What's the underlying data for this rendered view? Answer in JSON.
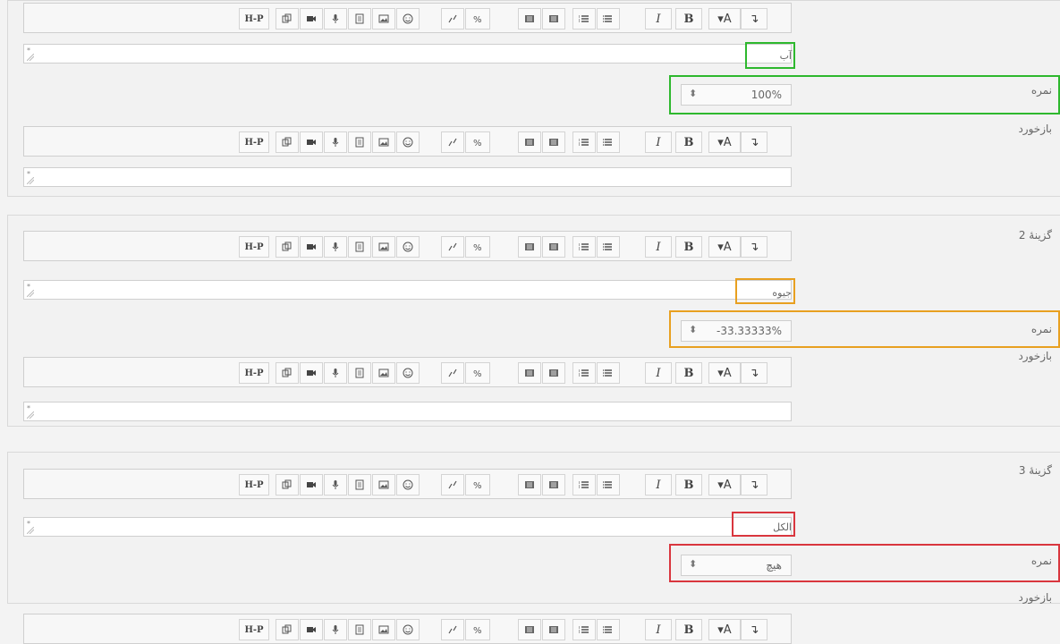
{
  "toolbar_icons": [
    "undo-icon",
    "font-color-icon",
    "bold-icon",
    "italic-icon",
    "unordered-list-icon",
    "ordered-list-icon",
    "indent-icon",
    "outdent-icon",
    "link-icon",
    "unlink-icon",
    "emoticon-icon",
    "image-icon",
    "media-icon",
    "record-audio-icon",
    "record-video-icon",
    "manage-files-icon",
    "h5p-icon"
  ],
  "toolbar_labels": {
    "undo": "↴",
    "font_color": "▾A",
    "bold": "B",
    "italic": "I",
    "h5p": "H-P"
  },
  "block1": {
    "answer_text": "آب",
    "grade_label": "نمره",
    "grade_value": "100%",
    "feedback_label": "بازخورد",
    "highlight_color": "#2eb82e"
  },
  "block2": {
    "choice_label": "گزینهٔ 2",
    "answer_text": "جیوه",
    "grade_label": "نمره",
    "grade_value": "-33.33333%",
    "feedback_label": "بازخورد",
    "highlight_color": "#e8a020"
  },
  "block3": {
    "choice_label": "گزینهٔ 3",
    "answer_text": "الکل",
    "grade_label": "نمره",
    "grade_value": "هیچ",
    "feedback_label": "بازخورد",
    "highlight_color": "#d9363e"
  }
}
